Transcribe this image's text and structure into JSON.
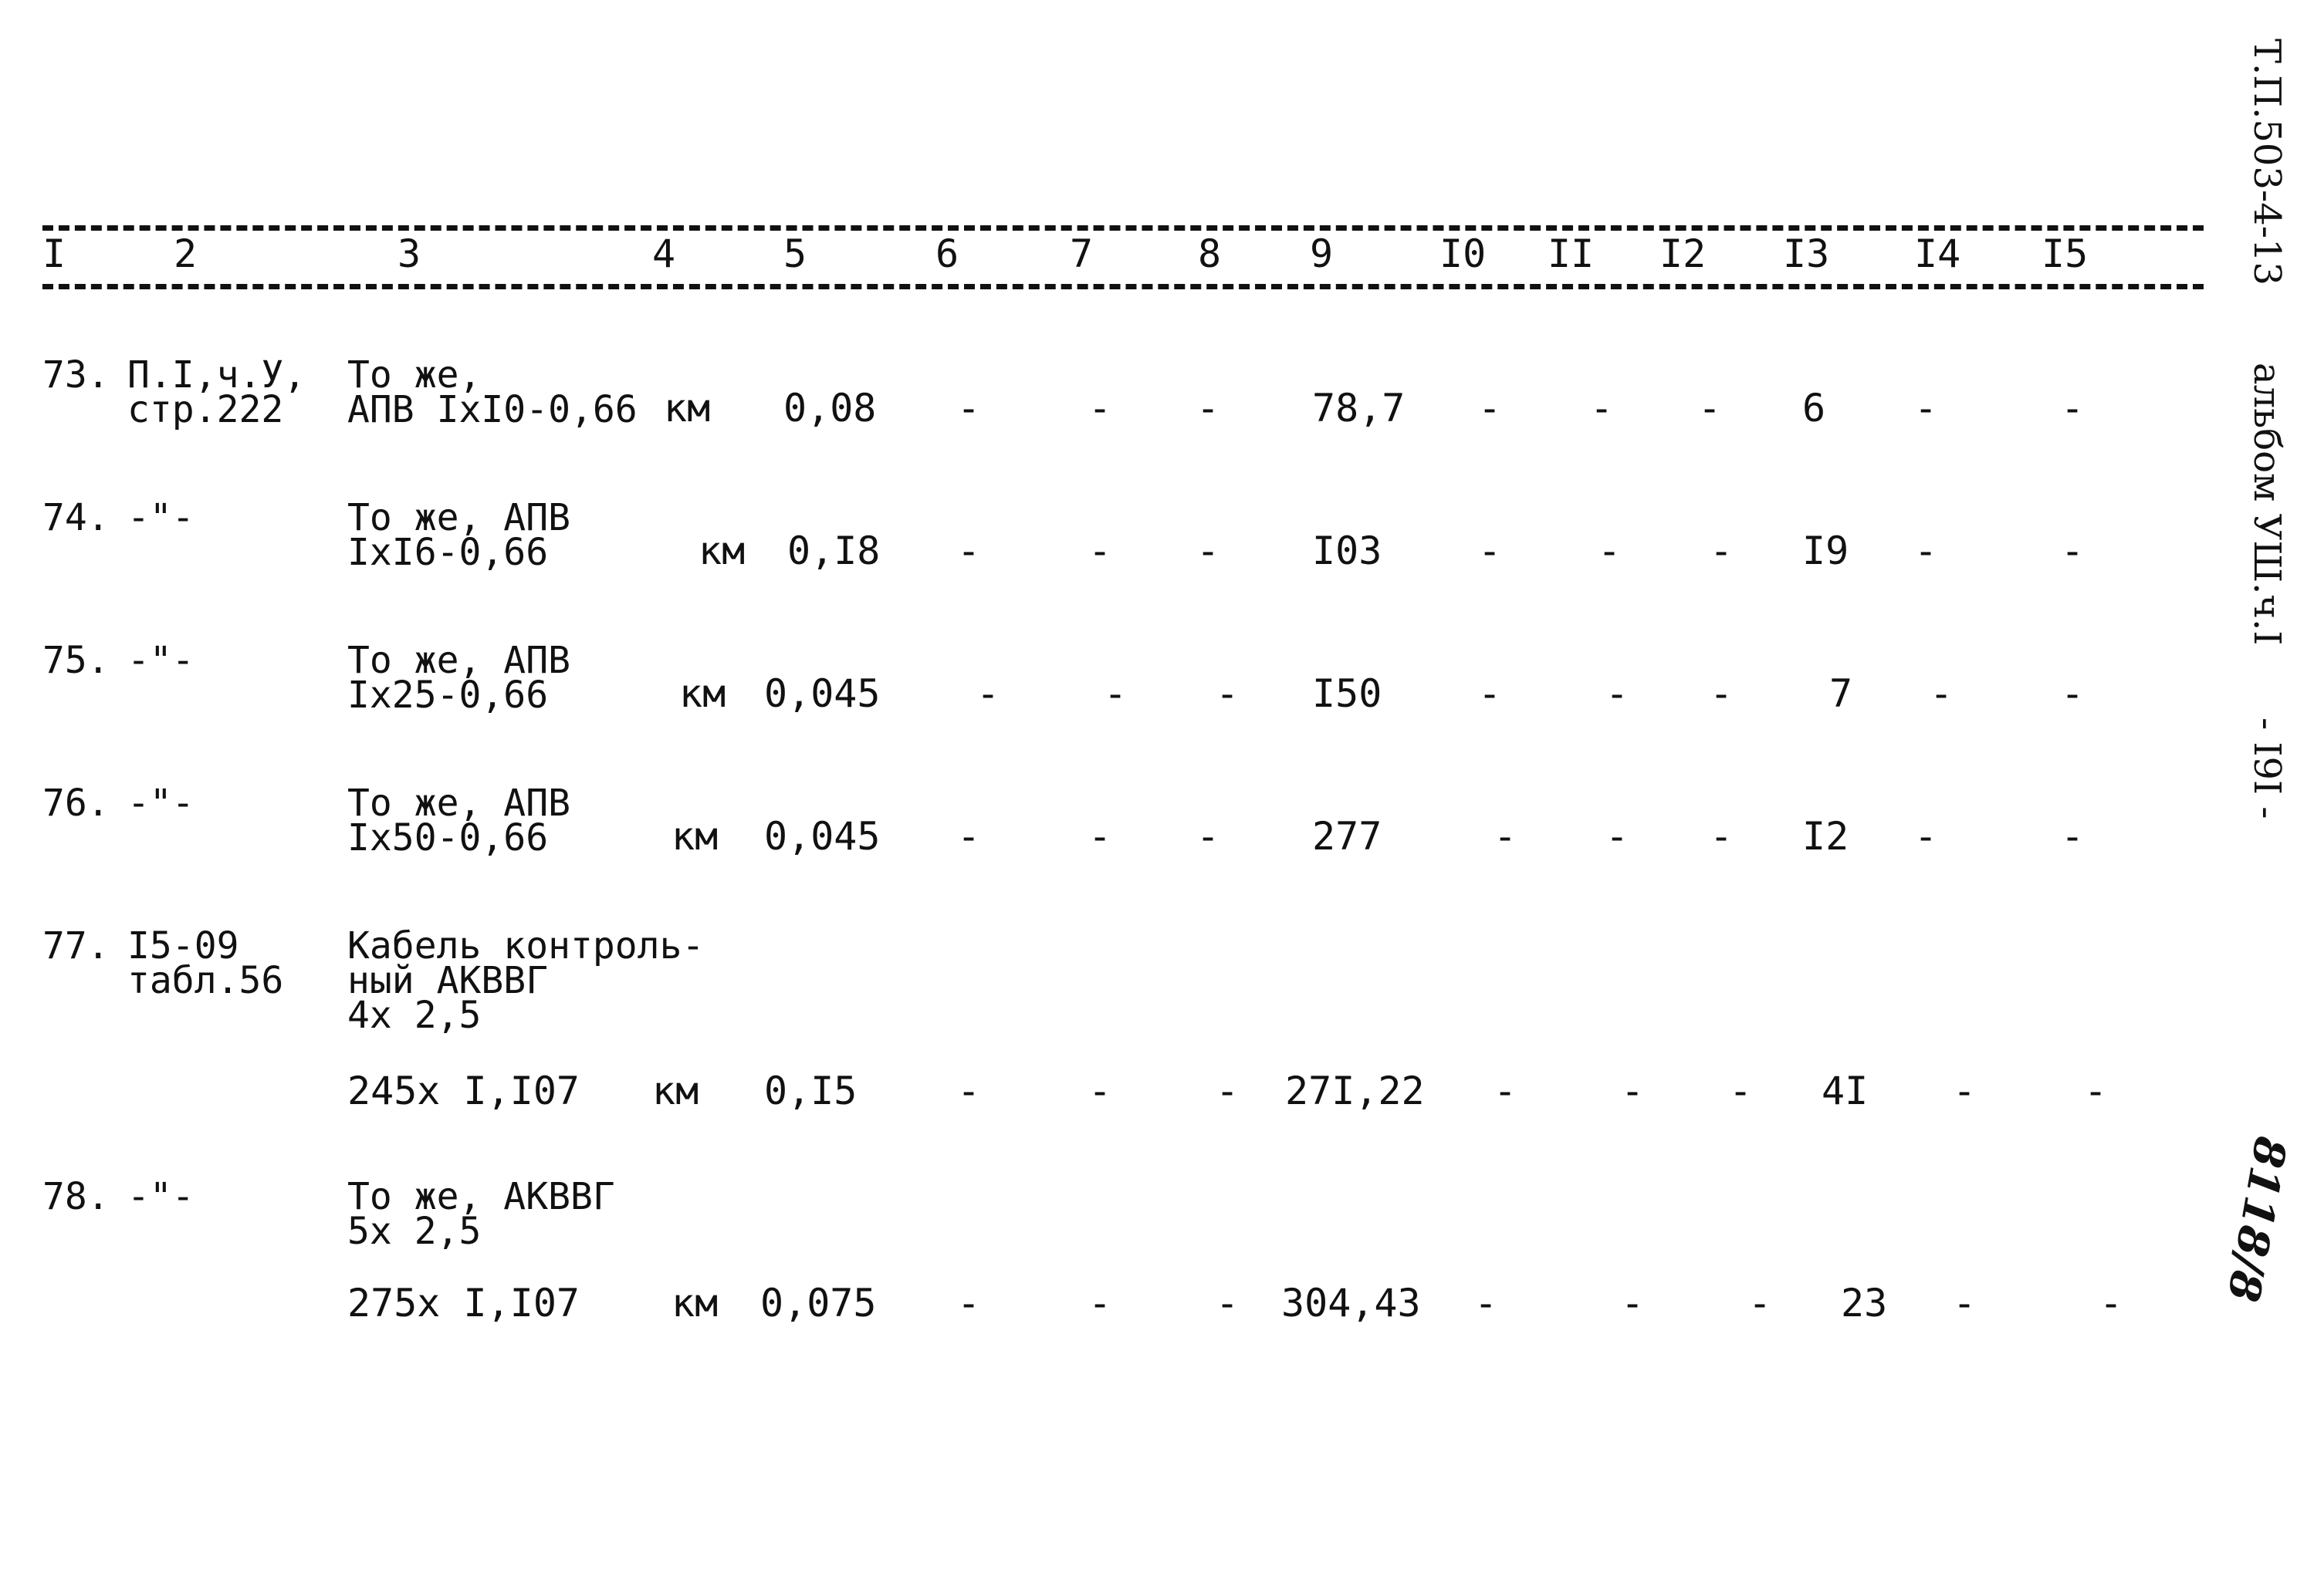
{
  "document": {
    "side_title": "Т.П.503-4-13",
    "side_album": "альбом УШ.ч.I",
    "page_number": "- I9I -",
    "handwritten_note": "8118/8"
  },
  "table": {
    "column_numbers": [
      "I",
      "2",
      "3",
      "4",
      "5",
      "6",
      "7",
      "8",
      "9",
      "I0",
      "II",
      "I2",
      "I3",
      "I4",
      "I5"
    ],
    "rows": [
      {
        "num": "73.",
        "ref": [
          "П.I,ч.У,",
          "стр.222"
        ],
        "desc": [
          "То же,",
          "АПВ IxI0-0,66"
        ],
        "unit": "км",
        "qty": "0,08",
        "c6": "-",
        "c7": "-",
        "c8": "-",
        "c9": "78,7",
        "c10": "-",
        "c11": "-",
        "c12": "-",
        "c13": "6",
        "c14": "-",
        "c15": "-"
      },
      {
        "num": "74.",
        "ref": [
          "-\"-"
        ],
        "desc": [
          "То же, АПВ",
          "IxI6-0,66"
        ],
        "unit": "км",
        "qty": "0,I8",
        "c6": "-",
        "c7": "-",
        "c8": "-",
        "c9": "I03",
        "c10": "-",
        "c11": "-",
        "c12": "-",
        "c13": "I9",
        "c14": "-",
        "c15": "-"
      },
      {
        "num": "75.",
        "ref": [
          "-\"-"
        ],
        "desc": [
          "То же, АПВ",
          "Ix25-0,66"
        ],
        "unit": "км",
        "qty": "0,045",
        "c6": "-",
        "c7": "-",
        "c8": "-",
        "c9": "I50",
        "c10": "-",
        "c11": "-",
        "c12": "-",
        "c13": "7",
        "c14": "-",
        "c15": "-"
      },
      {
        "num": "76.",
        "ref": [
          "-\"-"
        ],
        "desc": [
          "То же, АПВ",
          "Ix50-0,66"
        ],
        "unit": "км",
        "qty": "0,045",
        "c6": "-",
        "c7": "-",
        "c8": "-",
        "c9": "277",
        "c10": "-",
        "c11": "-",
        "c12": "-",
        "c13": "I2",
        "c14": "-",
        "c15": "-"
      },
      {
        "num": "77.",
        "ref": [
          "I5-09",
          "табл.56"
        ],
        "desc": [
          "Кабель контроль-",
          "ный АКВВГ",
          "4x 2,5"
        ],
        "calc": "245x I,I07",
        "unit": "км",
        "qty": "0,I5",
        "c6": "-",
        "c7": "-",
        "c8": "-",
        "c9": "27I,22",
        "c10": "-",
        "c11": "-",
        "c12": "-",
        "c13": "4I",
        "c14": "-",
        "c15": "-"
      },
      {
        "num": "78.",
        "ref": [
          "-\"-"
        ],
        "desc": [
          "То же, АКВВГ",
          "5x 2,5"
        ],
        "calc": "275x I,I07",
        "unit": "км",
        "qty": "0,075",
        "c6": "-",
        "c7": "-",
        "c8": "-",
        "c9": "304,43",
        "c10": "-",
        "c11": "-",
        "c12": "-",
        "c13": "23",
        "c14": "-",
        "c15": "-"
      }
    ]
  }
}
